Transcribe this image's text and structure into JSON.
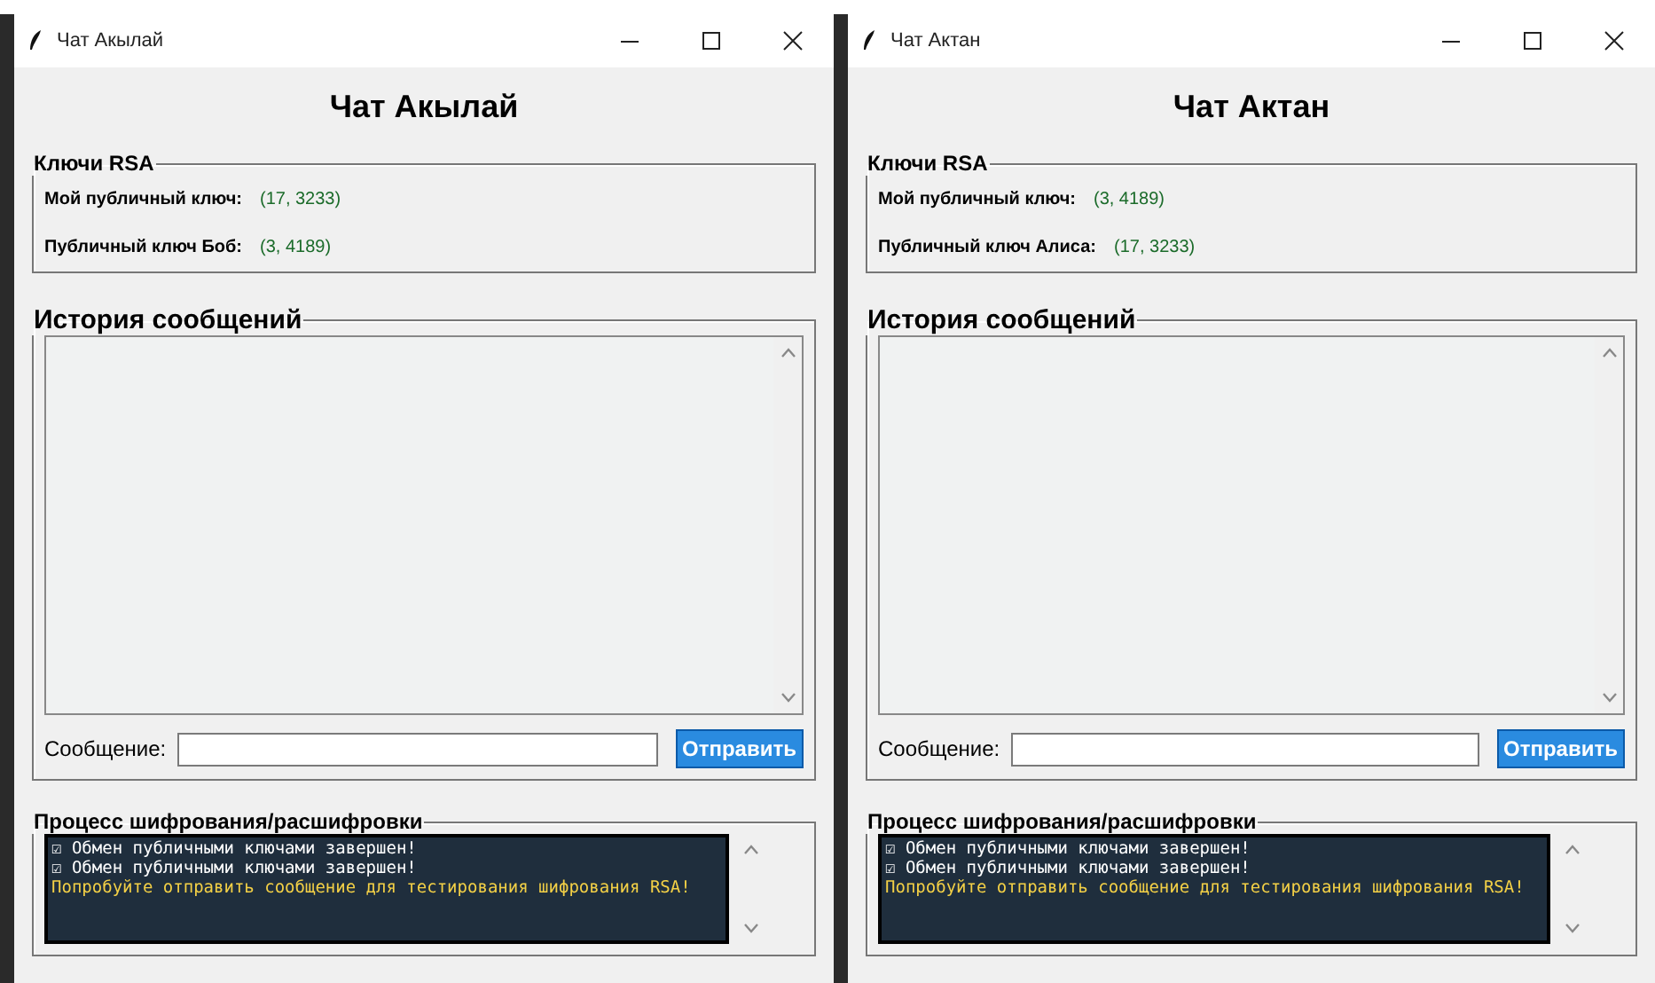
{
  "windows": [
    {
      "title": "Чат Акылай",
      "heading": "Чат Акылай",
      "keys_group": {
        "title": "Ключи RSA",
        "rows": [
          {
            "label": "Мой публичный ключ:",
            "value": "(17, 3233)"
          },
          {
            "label": "Публичный ключ Боб:",
            "value": "(3, 4189)"
          }
        ]
      },
      "history": {
        "title": "История сообщений"
      },
      "message": {
        "label": "Сообщение:",
        "button": "Отправить"
      },
      "process": {
        "title": "Процесс шифрования/расшифровки",
        "lines": [
          {
            "kind": "status",
            "text": "☑ Обмен публичными ключами завершен!"
          },
          {
            "kind": "status",
            "text": "☑ Обмен публичными ключами завершен!"
          },
          {
            "kind": "hint",
            "text": "Попробуйте отправить сообщение для тестирования шифрования RSA!"
          }
        ]
      }
    },
    {
      "title": "Чат Актан",
      "heading": "Чат Актан",
      "keys_group": {
        "title": "Ключи RSA",
        "rows": [
          {
            "label": "Мой публичный ключ:",
            "value": "(3, 4189)"
          },
          {
            "label": "Публичный ключ Алиса:",
            "value": "(17, 3233)"
          }
        ]
      },
      "history": {
        "title": "История сообщений"
      },
      "message": {
        "label": "Сообщение:",
        "button": "Отправить"
      },
      "process": {
        "title": "Процесс шифрования/расшифровки",
        "lines": [
          {
            "kind": "status",
            "text": "☑ Обмен публичными ключами завершен!"
          },
          {
            "kind": "status",
            "text": "☑ Обмен публичными ключами завершен!"
          },
          {
            "kind": "hint",
            "text": "Попробуйте отправить сообщение для тестирования шифрования RSA!"
          }
        ]
      }
    }
  ]
}
